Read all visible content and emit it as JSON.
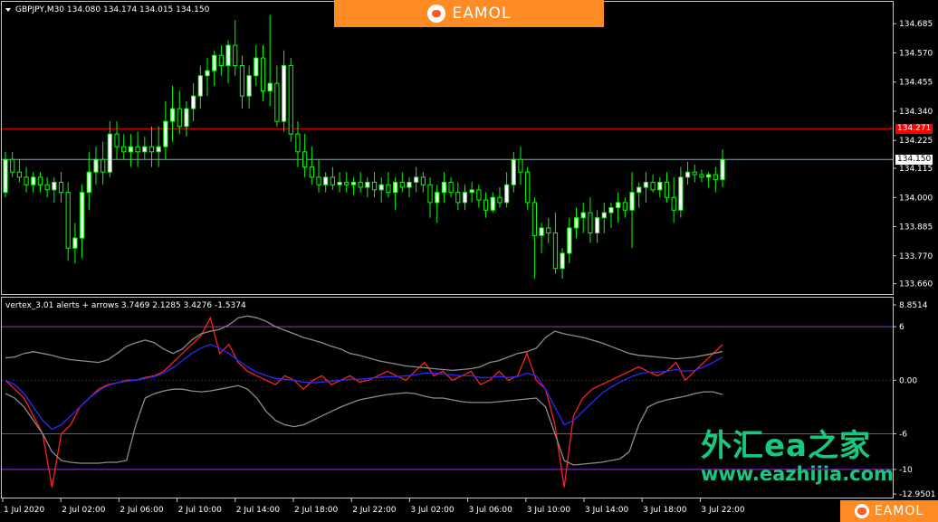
{
  "main": {
    "symbol_header": "GBPJPY,M30  134.080 134.174 134.015 134.150",
    "price_ticks": [
      "134.685",
      "134.570",
      "134.455",
      "134.340",
      "134.225",
      "134.115",
      "134.000",
      "133.885",
      "133.770",
      "133.660"
    ],
    "red_line_label": "134.271",
    "current_price_label": "134.150"
  },
  "indicator": {
    "header": "vertex_3.01 alerts + arrows 3.7469 2.1285 3.4276 -1.5374",
    "ticks": [
      "8.8514",
      "6",
      "0.00",
      "-6",
      "-10",
      "-12.9501"
    ]
  },
  "time_axis": {
    "labels": [
      "1 Jul 2020",
      "2 Jul 02:00",
      "2 Jul 06:00",
      "2 Jul 10:00",
      "2 Jul 14:00",
      "2 Jul 18:00",
      "2 Jul 22:00",
      "3 Jul 02:00",
      "3 Jul 06:00",
      "3 Jul 10:00",
      "3 Jul 14:00",
      "3 Jul 18:00",
      "3 Jul 22:00"
    ]
  },
  "branding": {
    "logo_text": "EAMOL",
    "watermark_cn": "外汇ea之家",
    "watermark_url": "www.eazhijia.com"
  },
  "colors": {
    "bull": "#ffffff",
    "bear": "#00ff00",
    "red_line": "#ff0000",
    "current_line": "#8fa3b3",
    "level": "#9b30d9",
    "signal": "#ff2020",
    "ma": "#2a2aff",
    "band": "#8c8c8c"
  },
  "chart_data": {
    "type": "candlestick",
    "x_start": "1 Jul 2020 23:00",
    "interval_minutes": 30,
    "ylim": [
      133.63,
      134.75
    ],
    "red_line": 134.271,
    "current_price": 134.15,
    "ohlc": [
      [
        134.02,
        134.18,
        134.0,
        134.15
      ],
      [
        134.15,
        134.18,
        134.08,
        134.1
      ],
      [
        134.1,
        134.15,
        134.06,
        134.08
      ],
      [
        134.08,
        134.12,
        134.02,
        134.05
      ],
      [
        134.05,
        134.1,
        134.02,
        134.08
      ],
      [
        134.08,
        134.1,
        134.02,
        134.05
      ],
      [
        134.05,
        134.08,
        134.0,
        134.03
      ],
      [
        134.03,
        134.08,
        133.98,
        134.06
      ],
      [
        134.06,
        134.1,
        133.98,
        134.02
      ],
      [
        134.02,
        134.06,
        133.75,
        133.8
      ],
      [
        133.8,
        133.9,
        133.74,
        133.84
      ],
      [
        133.84,
        134.05,
        133.76,
        134.02
      ],
      [
        134.02,
        134.18,
        133.95,
        134.1
      ],
      [
        134.1,
        134.2,
        134.05,
        134.15
      ],
      [
        134.15,
        134.22,
        134.05,
        134.1
      ],
      [
        134.1,
        134.3,
        134.08,
        134.25
      ],
      [
        134.25,
        134.3,
        134.15,
        134.2
      ],
      [
        134.2,
        134.25,
        134.15,
        134.18
      ],
      [
        134.18,
        134.25,
        134.12,
        134.2
      ],
      [
        134.2,
        134.26,
        134.12,
        134.18
      ],
      [
        134.18,
        134.24,
        134.15,
        134.2
      ],
      [
        134.2,
        134.28,
        134.12,
        134.18
      ],
      [
        134.18,
        134.28,
        134.12,
        134.2
      ],
      [
        134.2,
        134.38,
        134.15,
        134.3
      ],
      [
        134.3,
        134.44,
        134.22,
        134.35
      ],
      [
        134.35,
        134.42,
        134.25,
        134.28
      ],
      [
        134.28,
        134.38,
        134.24,
        134.35
      ],
      [
        134.35,
        134.45,
        134.3,
        134.4
      ],
      [
        134.4,
        134.52,
        134.35,
        134.48
      ],
      [
        134.48,
        134.55,
        134.4,
        134.5
      ],
      [
        134.5,
        134.58,
        134.44,
        134.56
      ],
      [
        134.56,
        134.6,
        134.48,
        134.52
      ],
      [
        134.52,
        134.62,
        134.45,
        134.6
      ],
      [
        134.6,
        134.7,
        134.48,
        134.52
      ],
      [
        134.52,
        134.56,
        134.35,
        134.4
      ],
      [
        134.4,
        134.52,
        134.35,
        134.48
      ],
      [
        134.48,
        134.6,
        134.44,
        134.55
      ],
      [
        134.55,
        134.6,
        134.38,
        134.42
      ],
      [
        134.42,
        134.72,
        134.36,
        134.45
      ],
      [
        134.45,
        134.52,
        134.28,
        134.3
      ],
      [
        134.3,
        134.58,
        134.26,
        134.52
      ],
      [
        134.52,
        134.55,
        134.22,
        134.25
      ],
      [
        134.25,
        134.3,
        134.12,
        134.18
      ],
      [
        134.18,
        134.25,
        134.08,
        134.12
      ],
      [
        134.12,
        134.2,
        134.05,
        134.08
      ],
      [
        134.08,
        134.15,
        134.02,
        134.05
      ],
      [
        134.05,
        134.1,
        134.02,
        134.08
      ],
      [
        134.08,
        134.12,
        134.03,
        134.05
      ],
      [
        134.05,
        134.1,
        134.02,
        134.06
      ],
      [
        134.06,
        134.1,
        134.02,
        134.05
      ],
      [
        134.05,
        134.08,
        134.01,
        134.06
      ],
      [
        134.06,
        134.1,
        134.02,
        134.04
      ],
      [
        134.04,
        134.08,
        134.0,
        134.06
      ],
      [
        134.06,
        134.1,
        134.0,
        134.03
      ],
      [
        134.03,
        134.08,
        133.98,
        134.05
      ],
      [
        134.05,
        134.1,
        134.0,
        134.02
      ],
      [
        134.02,
        134.08,
        133.95,
        134.06
      ],
      [
        134.06,
        134.1,
        134.02,
        134.04
      ],
      [
        134.04,
        134.08,
        134.0,
        134.06
      ],
      [
        134.06,
        134.12,
        134.02,
        134.08
      ],
      [
        134.08,
        134.1,
        134.02,
        134.05
      ],
      [
        134.05,
        134.08,
        133.92,
        133.98
      ],
      [
        133.98,
        134.05,
        133.9,
        134.02
      ],
      [
        134.02,
        134.1,
        133.98,
        134.06
      ],
      [
        134.06,
        134.08,
        134.0,
        134.02
      ],
      [
        134.02,
        134.06,
        133.95,
        133.98
      ],
      [
        133.98,
        134.05,
        133.95,
        134.02
      ],
      [
        134.02,
        134.06,
        133.98,
        134.03
      ],
      [
        134.03,
        134.05,
        133.96,
        133.99
      ],
      [
        133.99,
        134.02,
        133.92,
        133.95
      ],
      [
        133.95,
        134.02,
        133.94,
        134.0
      ],
      [
        134.0,
        134.04,
        133.96,
        133.98
      ],
      [
        133.98,
        134.1,
        133.96,
        134.05
      ],
      [
        134.05,
        134.18,
        134.02,
        134.15
      ],
      [
        134.15,
        134.2,
        134.05,
        134.1
      ],
      [
        134.1,
        134.12,
        133.95,
        133.98
      ],
      [
        133.98,
        134.0,
        133.68,
        133.85
      ],
      [
        133.85,
        133.9,
        133.78,
        133.88
      ],
      [
        133.88,
        133.92,
        133.82,
        133.86
      ],
      [
        133.86,
        133.94,
        133.7,
        133.72
      ],
      [
        133.72,
        133.8,
        133.68,
        133.78
      ],
      [
        133.78,
        133.92,
        133.74,
        133.88
      ],
      [
        133.88,
        133.96,
        133.84,
        133.92
      ],
      [
        133.92,
        133.98,
        133.86,
        133.94
      ],
      [
        133.94,
        134.0,
        133.82,
        133.86
      ],
      [
        133.86,
        133.95,
        133.82,
        133.92
      ],
      [
        133.92,
        133.98,
        133.86,
        133.94
      ],
      [
        133.94,
        133.98,
        133.88,
        133.96
      ],
      [
        133.96,
        134.02,
        133.9,
        133.98
      ],
      [
        133.98,
        134.0,
        133.92,
        133.95
      ],
      [
        133.95,
        134.1,
        133.8,
        134.02
      ],
      [
        134.02,
        134.06,
        133.96,
        134.04
      ],
      [
        134.04,
        134.1,
        133.98,
        134.06
      ],
      [
        134.06,
        134.09,
        134.02,
        134.03
      ],
      [
        134.03,
        134.08,
        134.0,
        134.06
      ],
      [
        134.06,
        134.1,
        133.98,
        134.0
      ],
      [
        134.0,
        134.08,
        133.9,
        133.95
      ],
      [
        133.95,
        134.12,
        133.92,
        134.08
      ],
      [
        134.08,
        134.14,
        134.05,
        134.1
      ],
      [
        134.1,
        134.13,
        134.06,
        134.09
      ],
      [
        134.09,
        134.11,
        134.06,
        134.08
      ],
      [
        134.08,
        134.1,
        134.04,
        134.09
      ],
      [
        134.09,
        134.12,
        134.02,
        134.07
      ],
      [
        134.07,
        134.19,
        134.04,
        134.15
      ]
    ],
    "indicator": {
      "ylim": [
        -12.9501,
        8.8514
      ],
      "levels": [
        6,
        0,
        -6,
        -10
      ],
      "series": [
        {
          "name": "signal",
          "values": [
            0,
            -1,
            -2,
            -4,
            -6,
            -12,
            -6,
            -5,
            -3,
            -2,
            -1,
            -0.5,
            -0.3,
            0,
            0,
            0.3,
            0.5,
            1,
            2,
            3,
            4,
            5,
            7,
            3,
            4,
            2,
            1,
            0.5,
            0,
            -0.5,
            0.5,
            0,
            -1,
            0,
            0.5,
            -0.5,
            0,
            0.5,
            -0.2,
            0,
            0.5,
            1,
            0.5,
            0,
            1,
            2,
            0.5,
            1,
            0,
            0.5,
            1,
            -0.5,
            0,
            1,
            0,
            0.5,
            3,
            0,
            -1,
            -5,
            -12,
            -4,
            -2,
            -1,
            -0.5,
            0,
            0.5,
            1,
            1.5,
            1,
            0.5,
            1,
            2,
            0,
            1,
            2,
            3,
            4
          ]
        },
        {
          "name": "ma",
          "values": [
            0,
            -0.5,
            -1.5,
            -3,
            -4.5,
            -5.5,
            -5,
            -4,
            -3,
            -2,
            -1.2,
            -0.6,
            -0.3,
            -0.1,
            0,
            0.2,
            0.4,
            0.8,
            1.4,
            2.2,
            3,
            3.6,
            4,
            3.6,
            3,
            2.2,
            1.5,
            0.9,
            0.5,
            0.2,
            0.1,
            0,
            -0.2,
            -0.3,
            -0.2,
            -0.1,
            0,
            0.1,
            0.1,
            0.2,
            0.3,
            0.4,
            0.4,
            0.5,
            0.6,
            0.8,
            0.8,
            0.7,
            0.6,
            0.5,
            0.5,
            0.3,
            0.3,
            0.4,
            0.3,
            0.4,
            0.8,
            0.5,
            -1,
            -3,
            -5,
            -4.5,
            -3.5,
            -2.5,
            -1.5,
            -0.8,
            -0.2,
            0.3,
            0.7,
            0.9,
            0.9,
            1,
            1.2,
            1,
            1.1,
            1.5,
            2,
            2.6
          ]
        },
        {
          "name": "upper",
          "values": [
            2.5,
            2.6,
            3,
            3.2,
            3,
            2.8,
            2.5,
            2.3,
            2.2,
            2.1,
            2,
            2.3,
            3,
            3.8,
            4.2,
            4.5,
            4.2,
            3.5,
            3,
            3.5,
            4.5,
            5.2,
            5.5,
            5.7,
            6.2,
            7,
            7.2,
            7,
            6.6,
            6,
            5.6,
            5.2,
            4.8,
            4.5,
            4.2,
            3.8,
            3.5,
            3,
            2.8,
            2.5,
            2.2,
            2,
            1.8,
            1.6,
            1.5,
            1.4,
            1.3,
            1.2,
            1.1,
            1.2,
            1.3,
            1.5,
            2,
            2.2,
            2.6,
            3,
            3.2,
            3.6,
            4.8,
            5.5,
            5.2,
            5,
            4.8,
            4.5,
            4.2,
            3.8,
            3.4,
            3,
            2.8,
            2.7,
            2.6,
            2.5,
            2.4,
            2.5,
            2.6,
            2.8,
            3,
            3.2
          ]
        },
        {
          "name": "lower",
          "values": [
            -1.5,
            -2,
            -3,
            -4.5,
            -6,
            -8,
            -9,
            -9.2,
            -9.3,
            -9.3,
            -9.3,
            -9.2,
            -9.2,
            -9,
            -5,
            -2,
            -1.5,
            -1.2,
            -1,
            -1,
            -1.2,
            -1.3,
            -1.2,
            -1,
            -0.8,
            -0.6,
            -1,
            -2,
            -3.5,
            -4.5,
            -5,
            -5.2,
            -5,
            -4.5,
            -4,
            -3.5,
            -3,
            -2.6,
            -2.2,
            -2,
            -1.8,
            -1.6,
            -1.5,
            -1.4,
            -1.5,
            -1.8,
            -2,
            -2,
            -2.2,
            -2.4,
            -2.5,
            -2.5,
            -2.5,
            -2.4,
            -2.3,
            -2.2,
            -2.1,
            -2,
            -3,
            -6,
            -9,
            -9.5,
            -9.4,
            -9.3,
            -9.2,
            -9,
            -8.8,
            -8,
            -5,
            -3,
            -2.5,
            -2.2,
            -2,
            -1.8,
            -1.5,
            -1.3,
            -1.3,
            -1.6
          ]
        }
      ]
    }
  }
}
